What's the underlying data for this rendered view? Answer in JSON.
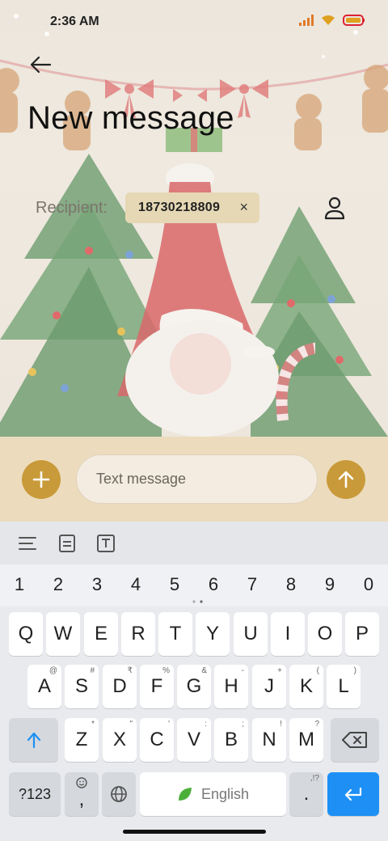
{
  "status_bar": {
    "time": "2:36 AM",
    "icons": [
      "signal-icon",
      "wifi-icon",
      "battery-icon"
    ]
  },
  "header": {
    "title": "New message"
  },
  "recipient": {
    "label": "Recipient:",
    "chips": [
      {
        "number": "18730218809"
      }
    ]
  },
  "compose": {
    "placeholder": "Text message"
  },
  "keyboard": {
    "toolbar": [
      "menu-lines-icon",
      "clipboard-icon",
      "text-box-icon"
    ],
    "number_row": [
      "1",
      "2",
      "3",
      "4",
      "5",
      "6",
      "7",
      "8",
      "9",
      "0"
    ],
    "row1": [
      {
        "k": "Q",
        "s": ""
      },
      {
        "k": "W",
        "s": ""
      },
      {
        "k": "E",
        "s": ""
      },
      {
        "k": "R",
        "s": ""
      },
      {
        "k": "T",
        "s": ""
      },
      {
        "k": "Y",
        "s": ""
      },
      {
        "k": "U",
        "s": ""
      },
      {
        "k": "I",
        "s": ""
      },
      {
        "k": "O",
        "s": ""
      },
      {
        "k": "P",
        "s": ""
      }
    ],
    "row2": [
      {
        "k": "A",
        "s": "@"
      },
      {
        "k": "S",
        "s": "#"
      },
      {
        "k": "D",
        "s": "₹"
      },
      {
        "k": "F",
        "s": "%"
      },
      {
        "k": "G",
        "s": "&"
      },
      {
        "k": "H",
        "s": "-"
      },
      {
        "k": "J",
        "s": "+"
      },
      {
        "k": "K",
        "s": "("
      },
      {
        "k": "L",
        "s": ")"
      }
    ],
    "row3": [
      {
        "k": "Z",
        "s": "*"
      },
      {
        "k": "X",
        "s": "\""
      },
      {
        "k": "C",
        "s": "'"
      },
      {
        "k": "V",
        "s": ":"
      },
      {
        "k": "B",
        "s": ";"
      },
      {
        "k": "N",
        "s": "!"
      },
      {
        "k": "M",
        "s": "?"
      }
    ],
    "symbols_label": "?123",
    "comma_label": ",",
    "space_label": "English",
    "period_label": ".",
    "period_sub": ",!?"
  },
  "colors": {
    "accent": "#c99a3a",
    "compose_bg": "#ecdcbd",
    "chip_bg": "#e6d8b5",
    "enter_key": "#1e90f5"
  }
}
